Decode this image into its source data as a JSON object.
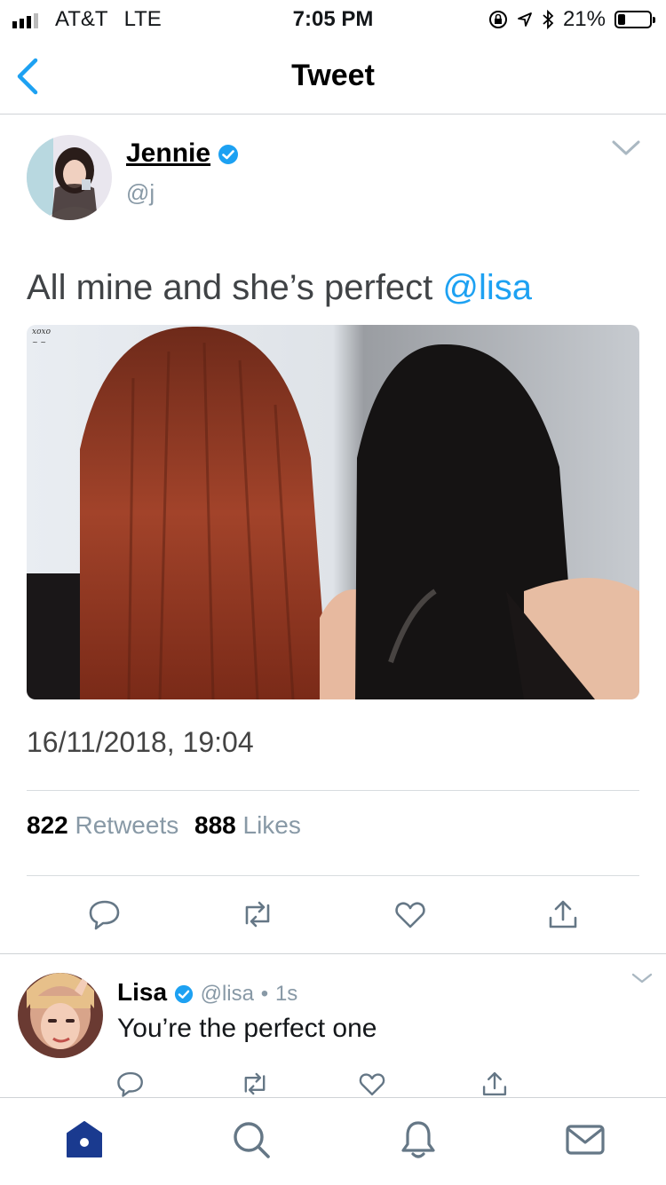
{
  "status_bar": {
    "carrier": "AT&T",
    "network": "LTE",
    "time": "7:05 PM",
    "battery": "21%"
  },
  "nav": {
    "title": "Tweet",
    "back_icon": "chevron-left-icon"
  },
  "tweet": {
    "author_name": "Jennie",
    "author_handle": "@j",
    "verified": true,
    "text": "All mine and she’s perfect",
    "mention": "@lisa",
    "timestamp": "16/11/2018, 19:04",
    "retweets_count": "822",
    "retweets_label": "Retweets",
    "likes_count": "888",
    "likes_label": "Likes",
    "actions": [
      "reply-icon",
      "retweet-icon",
      "like-icon",
      "share-icon"
    ]
  },
  "reply": {
    "author_name": "Lisa",
    "author_handle": "@lisa",
    "separator": "•",
    "age": "1s",
    "text": "You’re the perfect one"
  },
  "tab_bar": {
    "items": [
      "home-icon",
      "search-icon",
      "notifications-icon",
      "messages-icon"
    ],
    "accent": "#1da1f2",
    "home_color": "#1a3a8f"
  }
}
